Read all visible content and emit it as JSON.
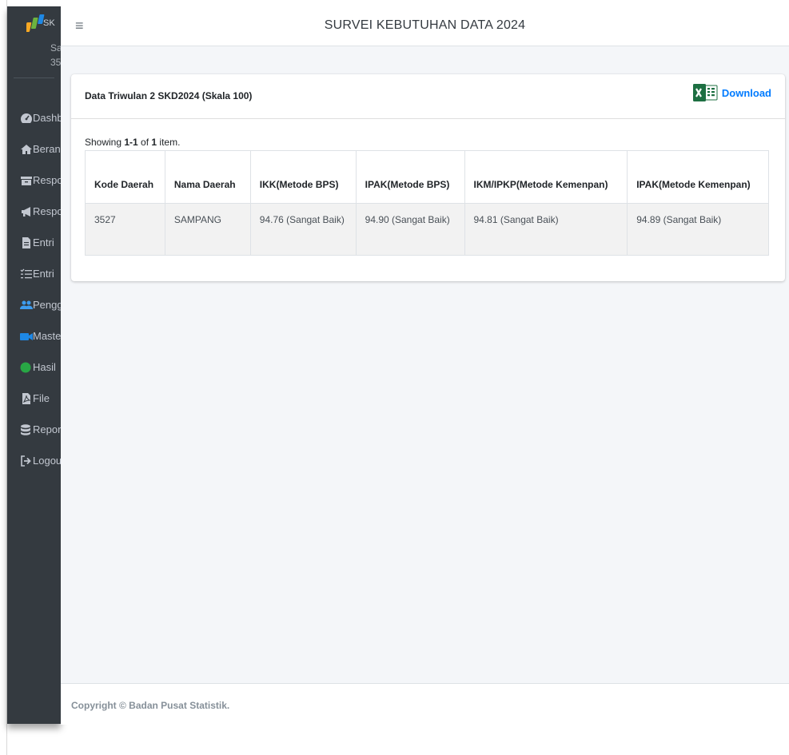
{
  "sidebar": {
    "brand_text": "SK",
    "brand_sub1": "Sa",
    "brand_sub2": "35",
    "items": [
      {
        "label": "Dashboard",
        "icon": "dashboard-gauge-icon"
      },
      {
        "label": "Beranda",
        "icon": "home-icon"
      },
      {
        "label": "Responden",
        "icon": "archive-box-icon"
      },
      {
        "label": "Respon",
        "icon": "bullhorn-icon"
      },
      {
        "label": "Entri",
        "icon": "file-icon"
      },
      {
        "label": "Entri",
        "icon": "list-check-icon"
      },
      {
        "label": "Pengguna",
        "icon": "users-icon"
      },
      {
        "label": "Master",
        "icon": "video-icon"
      },
      {
        "label": "Hasil",
        "icon": "circle-icon"
      },
      {
        "label": "File",
        "icon": "pdf-file-icon"
      },
      {
        "label": "Report",
        "icon": "database-icon"
      },
      {
        "label": "Logout",
        "icon": "logout-icon"
      }
    ],
    "colors": {
      "background": "#343a40",
      "text": "#c2c7d0"
    }
  },
  "header": {
    "title": "SURVEI KEBUTUHAN DATA 2024"
  },
  "card": {
    "title": "Data Triwulan 2 SKD2024 (Skala 100)",
    "download_label": "Download",
    "summary_prefix": "Showing ",
    "summary_range": "1-1",
    "summary_mid": " of ",
    "summary_total": "1",
    "summary_suffix": " item."
  },
  "table": {
    "columns": [
      "Kode Daerah",
      "Nama Daerah",
      "IKK(Metode BPS)",
      "IPAK(Metode BPS)",
      "IKM/IPKP(Metode Kemenpan)",
      "IPAK(Metode Kemenpan)"
    ],
    "rows": [
      [
        "3527",
        "SAMPANG",
        "94.76 (Sangat Baik)",
        "94.90 (Sangat Baik)",
        "94.81 (Sangat Baik)",
        "94.89 (Sangat Baik)"
      ]
    ]
  },
  "footer": {
    "text": "Copyright © Badan Pusat Statistik."
  },
  "theme": {
    "accent": "#007bff",
    "excel_green": "#1d6f42",
    "content_bg": "#f4f6f9"
  }
}
